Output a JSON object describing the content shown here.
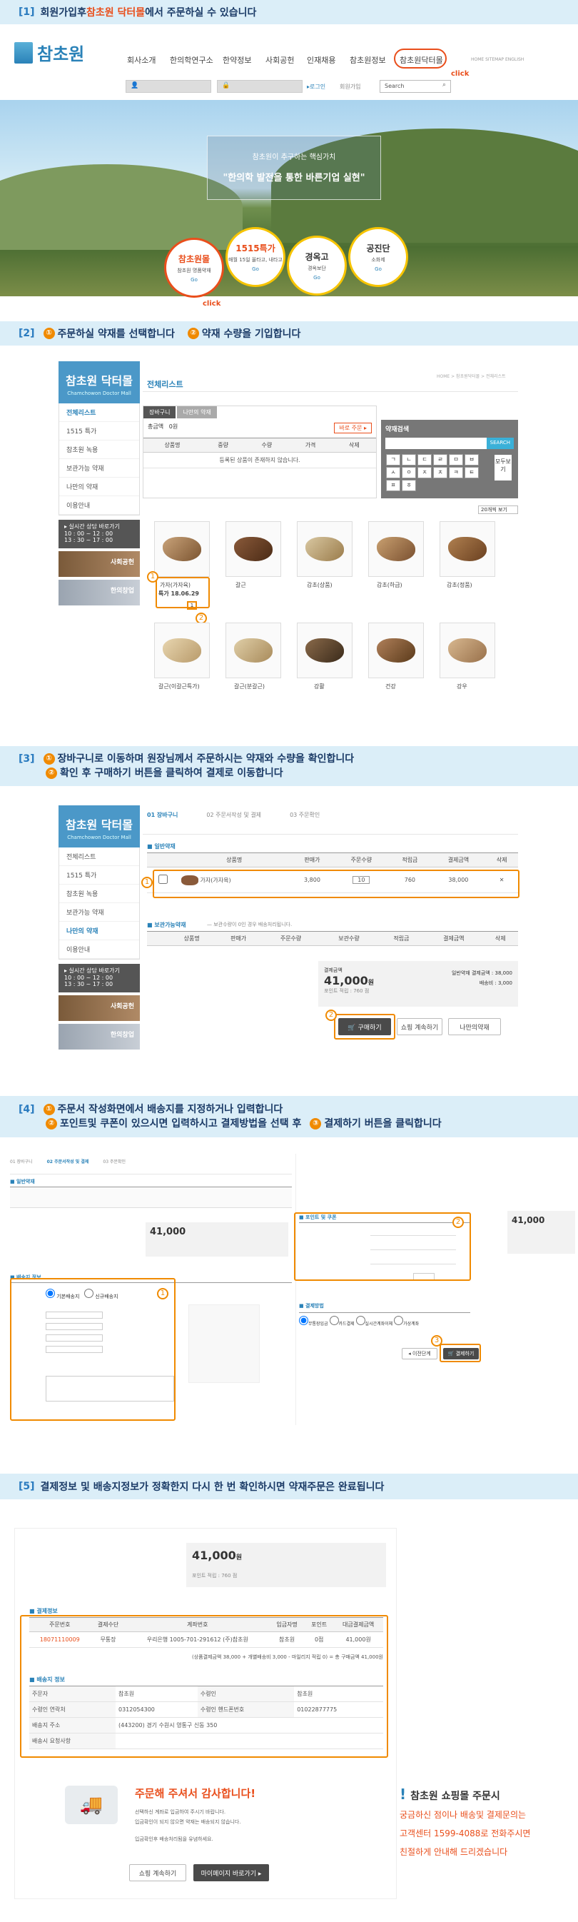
{
  "banners": {
    "s1": {
      "num": "[1]",
      "pre": "회원가입후 ",
      "hl": "참초원 닥터몰",
      "post": "에서 주문하실 수 있습니다"
    },
    "s2": {
      "num": "[2]",
      "c1": "①",
      "t1": "주문하실 약재를 선택합니다",
      "c2": "②",
      "t2": "약재 수량을 기입합니다"
    },
    "s3": {
      "num": "[3]",
      "c1": "①",
      "t1": "장바구니로 이동하며 원장님께서 주문하시는 약재와 수량을 확인합니다",
      "c2": "②",
      "t2": "확인 후 구매하기 버튼을 클릭하여 결제로 이동합니다"
    },
    "s4": {
      "num": "[4]",
      "c1": "①",
      "t1": "주문서 작성화면에서 배송지를 지정하거나 입력합니다",
      "c2": "②",
      "t2": "포인트및 쿠폰이 있으시면 입력하시고 결제방법을 선택 후",
      "c3": "③",
      "t3": "결제하기 버튼을 클릭합니다"
    },
    "s5": {
      "num": "[5]",
      "text": "결제정보 및 배송지정보가 정확한지  다시 한 번 확인하시면 약재주문은 완료됩니다"
    }
  },
  "header": {
    "logo": "참초원",
    "logo_sub": "CHAMCHOWON",
    "nav": [
      "회사소개",
      "한의학연구소",
      "한약정보",
      "사회공헌",
      "인재채용",
      "참초원정보",
      "참초원닥터몰"
    ],
    "top_links": "HOME  SITEMAP  ENGLISH",
    "login": "▸로그인",
    "join": "회원가입",
    "search_placeholder": "Search",
    "click1": "click"
  },
  "hero": {
    "subtitle": "참초원이 추구하는 핵심가치",
    "title": "\"한의학 발전을 통한 바른기업 실현\"",
    "buttons": [
      {
        "title": "참초원몰",
        "sub": "참초원 명품약재",
        "go": "Go"
      },
      {
        "title": "1515특가",
        "sub": "매월 15일 올타고, 내타고",
        "go": "Go"
      },
      {
        "title": "경옥고",
        "sub": "경옥보단",
        "go": "Go"
      },
      {
        "title": "공진단",
        "sub": "소화제",
        "go": "Go"
      }
    ],
    "click2": "click"
  },
  "mall": {
    "side_title": "참초원 닥터몰",
    "side_sub": "Chamchowon Doctor Mall",
    "side_items": [
      "전체리스트",
      "1515 특가",
      "참초원 녹용",
      "보관가능 약재",
      "나만의 약재",
      "이용안내"
    ],
    "consult_title": "▸ 실시간 상담 바로가기",
    "consult_time1": "10 : 00 ~ 12 : 00",
    "consult_time2": "13 : 30 ~ 17 : 00",
    "side_img1": "사회공헌",
    "side_img2": "한의창업",
    "list_title": "전체리스트",
    "breadcrumb": "HOME > 참초원닥터몰 > 전체리스트",
    "cart_tab1": "장바구니",
    "cart_tab2": "나만의 약재",
    "cart_cols": [
      "상품명",
      "중량",
      "수량",
      "가격",
      "삭제"
    ],
    "cart_empty": "등록된 상품이 존재하지 않습니다.",
    "total_label": "총금액",
    "total_value": "0원",
    "order_btn": "바로 주문 ▸",
    "search_title": "약재검색",
    "search_btn": "SEARCH",
    "keys": [
      "ㄱ",
      "ㄴ",
      "ㄷ",
      "ㄹ",
      "ㅁ",
      "ㅂ",
      "ㅅ",
      "ㅇ",
      "ㅈ",
      "ㅊ",
      "ㅋ",
      "ㅌ",
      "ㅍ",
      "ㅎ"
    ],
    "all_view": "모두보기",
    "per_page": "20개씩 보기",
    "products_row1": [
      "가자(가자육)",
      "갈근",
      "감초(상품)",
      "감초(하급)",
      "감초(정품)"
    ],
    "products_row2": [
      "갈근(이갈근특가)",
      "갈근(분갈근)",
      "강활",
      "건강",
      "강우"
    ],
    "price_hl": "특가 18.06.29",
    "qty_label": "주문수량"
  },
  "cart": {
    "steps": [
      "01 장바구니",
      "02 주문서작성 및 결제",
      "03 주문확인"
    ],
    "sec1": "■ 일반약재",
    "cols": [
      "상품명",
      "판매가",
      "주문수량",
      "적립금",
      "결제금액",
      "삭제"
    ],
    "row": {
      "name": "가자(가자육)",
      "price": "3,800",
      "qty": "10",
      "point": "760",
      "amount": "38,000"
    },
    "sec2": "■ 보관가능약재",
    "sec2_note": "— 보관수량이 0인 경우 배송처리됩니다.",
    "cols2": [
      "상품명",
      "판매가",
      "주문수량",
      "보관수량",
      "적립금",
      "결제금액",
      "삭제"
    ],
    "sum_label": "결제금액",
    "sum_value": "41,000",
    "sum_unit": "원",
    "sum_point": "포인트 적립 : 760 점",
    "sum_right1": "일반약재 결제금액 : 38,000",
    "sum_right2": "배송비 : 3,000",
    "buy_btn": "🛒 구매하기",
    "continue_btn": "쇼핑 계속하기",
    "my_btn": "나만의약재"
  },
  "order": {
    "steps": [
      "01 장바구니",
      "02 주문서작성 및 결제",
      "03 주문확인"
    ],
    "sec1": "■ 일반약재",
    "sum_value": "41,000",
    "ship_title": "■ 배송지 정보",
    "ship_opt1": "기본배송지",
    "ship_opt2": "신규배송지",
    "point_title": "■ 포인트 및 쿠폰",
    "pay_title": "■ 결제방법",
    "pay_opts": [
      "무통장입금",
      "카드결제",
      "실시간계좌이체",
      "가상계좌"
    ],
    "prev_btn": "◂ 이전단계",
    "pay_btn": "🛒 결제하기",
    "right_sum": "41,000"
  },
  "confirm": {
    "sum_value": "41,000",
    "sum_unit": "원",
    "point": "포인트 적립 : 760 점",
    "pay_title": "■ 결제정보",
    "pay_cols": [
      "주문번호",
      "결제수단",
      "계좌번호",
      "입금자명",
      "포인트",
      "대금결제금액"
    ],
    "pay_row": [
      "18071110009",
      "무통장",
      "우리은행 1005-701-291612 (주)참초원",
      "참초원",
      "0점",
      "41,000원"
    ],
    "pay_note": "(상품결제금액 38,000 + 개별배송비 3,000 - 마일리지 적립 0) = 총 구매금액 41,000원",
    "ship_title": "■ 배송지 정보",
    "ship_rows": [
      [
        "주문자",
        "참초원",
        "수령인",
        "참초원"
      ],
      [
        "수령인 연락처",
        "0312054300",
        "수령인 핸드폰번호",
        "01022877775"
      ],
      [
        "배송지 주소",
        "(443200) 경기 수원시 영통구 신동 350",
        "",
        ""
      ],
      [
        "배송시 요청사항",
        "",
        "",
        ""
      ]
    ],
    "thanks_title": "주문해 주셔서 감사합니다!",
    "thanks_l1": "선택하신 계좌로 입금하여 주시기 바랍니다.",
    "thanks_l2": "입금확인이 되지 않으면 약재는 배송되지 않습니다.",
    "thanks_l3": "입금확인후 배송처리됨을 유념하세요.",
    "btn_shop": "쇼핑 계속하기",
    "btn_my": "마이페이지 바로가기 ▸"
  },
  "notice": {
    "title": "참초원 쇼핑몰 주문시",
    "l1": "궁금하신 점이나 배송및 결제문의는",
    "l2": "고객센터 1599-4088로 전화주시면",
    "l3": "친절하게 안내해 드리겠습니다"
  }
}
